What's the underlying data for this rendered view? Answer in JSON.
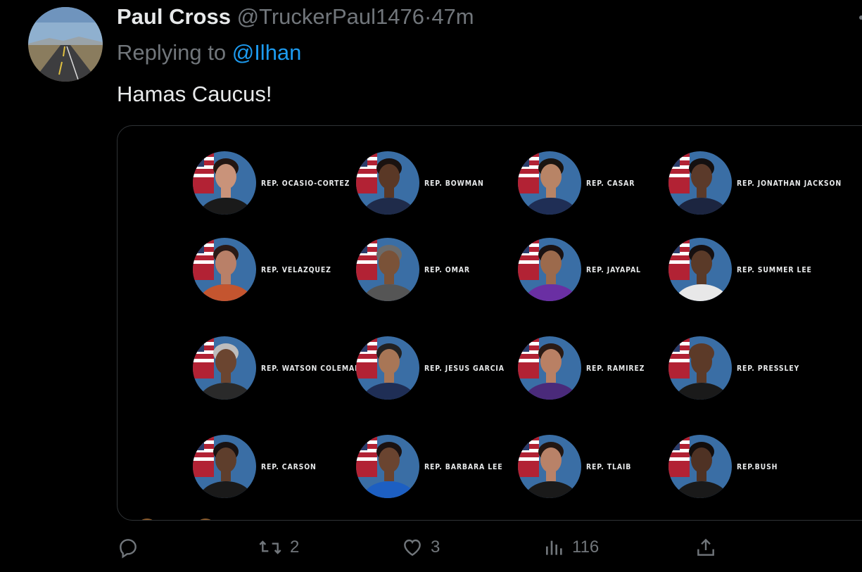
{
  "tweet": {
    "name": "Paul Cross",
    "handle": "@TruckerPaul1476",
    "separator": "·",
    "time": "47m",
    "replying_prefix": "Replying to",
    "replying_to": "@Ilhan",
    "text": "Hamas Caucus!"
  },
  "media": {
    "reps": [
      {
        "label": "REP. OCASIO-CORTEZ",
        "skin": "#c9937a",
        "outfit": "#1a1a1a",
        "hair": "#231612"
      },
      {
        "label": "REP. BOWMAN",
        "skin": "#5a3826",
        "outfit": "#1f2b4a",
        "hair": "#1a1210"
      },
      {
        "label": "REP. CASAR",
        "skin": "#b88466",
        "outfit": "#1f2e55",
        "hair": "#1a1410"
      },
      {
        "label": "REP. JONATHAN JACKSON",
        "skin": "#5b3a2a",
        "outfit": "#1c2540",
        "hair": "#141010"
      },
      {
        "label": "REP. VELAZQUEZ",
        "skin": "#b98068",
        "outfit": "#c4552f",
        "hair": "#2a1a16"
      },
      {
        "label": "REP. OMAR",
        "skin": "#7a5238",
        "outfit": "#555555",
        "hair": "#6b6b6b"
      },
      {
        "label": "REP. JAYAPAL",
        "skin": "#9c6a4c",
        "outfit": "#6a2fa3",
        "hair": "#1a1212"
      },
      {
        "label": "REP. SUMMER LEE",
        "skin": "#5a3a28",
        "outfit": "#e8e8e8",
        "hair": "#161010"
      },
      {
        "label": "REP. WATSON COLEMAN",
        "skin": "#6b4530",
        "outfit": "#2a2a2a",
        "hair": "#bdbdbd"
      },
      {
        "label": "REP. JESUS GARCIA",
        "skin": "#a87656",
        "outfit": "#1f2e55",
        "hair": "#222222"
      },
      {
        "label": "REP. RAMIREZ",
        "skin": "#b98064",
        "outfit": "#4a2a7a",
        "hair": "#2a1a14"
      },
      {
        "label": "REP. PRESSLEY",
        "skin": "#5c3a28",
        "outfit": "#1a1a1a",
        "hair": "#5c3a28"
      },
      {
        "label": "REP. CARSON",
        "skin": "#5e3e2c",
        "outfit": "#1a1a1a",
        "hair": "#181212"
      },
      {
        "label": "REP. BARBARA LEE",
        "skin": "#6a4430",
        "outfit": "#1d5fc2",
        "hair": "#1a1212"
      },
      {
        "label": "REP. TLAIB",
        "skin": "#b98268",
        "outfit": "#1a1a1a",
        "hair": "#221612"
      },
      {
        "label": "REP.BUSH",
        "skin": "#4f3224",
        "outfit": "#1a1a1a",
        "hair": "#120d0c"
      }
    ]
  },
  "actions": {
    "reply_icon": "reply-icon",
    "retweets": "2",
    "likes": "3",
    "views": "116",
    "share_icon": "share-icon"
  },
  "colors": {
    "background": "#000000",
    "accent": "#1d9bf0",
    "muted": "#71767b",
    "text": "#e7e9ea"
  }
}
